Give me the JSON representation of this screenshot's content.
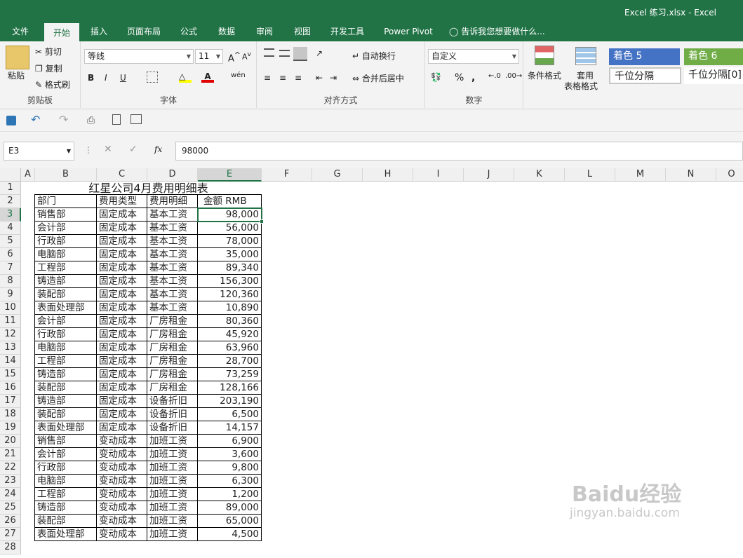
{
  "window": {
    "title": "Excel 练习.xlsx - Excel"
  },
  "tabs": [
    {
      "label": "文件",
      "x": 0
    },
    {
      "label": "开始",
      "x": 1
    },
    {
      "label": "插入",
      "x": 2
    },
    {
      "label": "页面布局",
      "x": 3
    },
    {
      "label": "公式",
      "x": 4
    },
    {
      "label": "数据",
      "x": 5
    },
    {
      "label": "审阅",
      "x": 6
    },
    {
      "label": "视图",
      "x": 7
    },
    {
      "label": "开发工具",
      "x": 8
    },
    {
      "label": "Power Pivot",
      "x": 9
    }
  ],
  "tell_me": "告诉我您想要做什么...",
  "ribbon": {
    "clipboard": {
      "paste": "粘贴",
      "cut": "剪切",
      "copy": "复制",
      "format_painter": "格式刷",
      "label": "剪贴板"
    },
    "font": {
      "name": "等线",
      "size": "11",
      "bold": "B",
      "italic": "I",
      "underline": "U",
      "label": "字体"
    },
    "alignment": {
      "wrap": "自动换行",
      "merge": "合并后居中",
      "label": "对齐方式"
    },
    "number": {
      "format": "自定义",
      "percent": "%",
      "comma": ",",
      "label": "数字"
    },
    "styles": {
      "conditional": "条件格式",
      "table_format_1": "套用",
      "table_format_2": "表格格式",
      "accent5": "着色 5",
      "accent6": "着色 6",
      "comma_style": "千位分隔",
      "comma0_style": "千位分隔[0]"
    }
  },
  "formula_bar": {
    "name_box": "E3",
    "value": "98000",
    "fx": "fx"
  },
  "columns": [
    "A",
    "B",
    "C",
    "D",
    "E",
    "F",
    "G",
    "H",
    "I",
    "J",
    "K",
    "L",
    "M",
    "N",
    "O"
  ],
  "rows": [
    "1",
    "2",
    "3",
    "4",
    "5",
    "6",
    "7",
    "8",
    "9",
    "10",
    "11",
    "12",
    "13",
    "14",
    "15",
    "16",
    "17",
    "18",
    "19",
    "20",
    "21",
    "22",
    "23",
    "24",
    "25",
    "26",
    "27",
    "28"
  ],
  "sheet": {
    "title": "红星公司4月费用明细表",
    "headers": [
      "部门",
      "费用类型",
      "费用明细",
      "金额 RMB"
    ],
    "data": [
      [
        "销售部",
        "固定成本",
        "基本工资",
        "98,000"
      ],
      [
        "会计部",
        "固定成本",
        "基本工资",
        "56,000"
      ],
      [
        "行政部",
        "固定成本",
        "基本工资",
        "78,000"
      ],
      [
        "电脑部",
        "固定成本",
        "基本工资",
        "35,000"
      ],
      [
        "工程部",
        "固定成本",
        "基本工资",
        "89,340"
      ],
      [
        "铸造部",
        "固定成本",
        "基本工资",
        "156,300"
      ],
      [
        "装配部",
        "固定成本",
        "基本工资",
        "120,360"
      ],
      [
        "表面处理部",
        "固定成本",
        "基本工资",
        "10,890"
      ],
      [
        "会计部",
        "固定成本",
        "厂房租金",
        "80,360"
      ],
      [
        "行政部",
        "固定成本",
        "厂房租金",
        "45,920"
      ],
      [
        "电脑部",
        "固定成本",
        "厂房租金",
        "63,960"
      ],
      [
        "工程部",
        "固定成本",
        "厂房租金",
        "28,700"
      ],
      [
        "铸造部",
        "固定成本",
        "厂房租金",
        "73,259"
      ],
      [
        "装配部",
        "固定成本",
        "厂房租金",
        "128,166"
      ],
      [
        "铸造部",
        "固定成本",
        "设备折旧",
        "203,190"
      ],
      [
        "装配部",
        "固定成本",
        "设备折旧",
        "6,500"
      ],
      [
        "表面处理部",
        "固定成本",
        "设备折旧",
        "14,157"
      ],
      [
        "销售部",
        "变动成本",
        "加班工资",
        "6,900"
      ],
      [
        "会计部",
        "变动成本",
        "加班工资",
        "3,600"
      ],
      [
        "行政部",
        "变动成本",
        "加班工资",
        "9,800"
      ],
      [
        "电脑部",
        "变动成本",
        "加班工资",
        "6,300"
      ],
      [
        "工程部",
        "变动成本",
        "加班工资",
        "1,200"
      ],
      [
        "铸造部",
        "变动成本",
        "加班工资",
        "89,000"
      ],
      [
        "装配部",
        "变动成本",
        "加班工资",
        "65,000"
      ],
      [
        "表面处理部",
        "变动成本",
        "加班工资",
        "4,500"
      ]
    ]
  },
  "watermark": {
    "brand": "Baidu经验",
    "url": "jingyan.baidu.com"
  },
  "colors": {
    "excel_green": "#217346",
    "ribbon_bg": "#f3f3f3",
    "accent5": "#4472c4",
    "accent6": "#70ad47"
  }
}
